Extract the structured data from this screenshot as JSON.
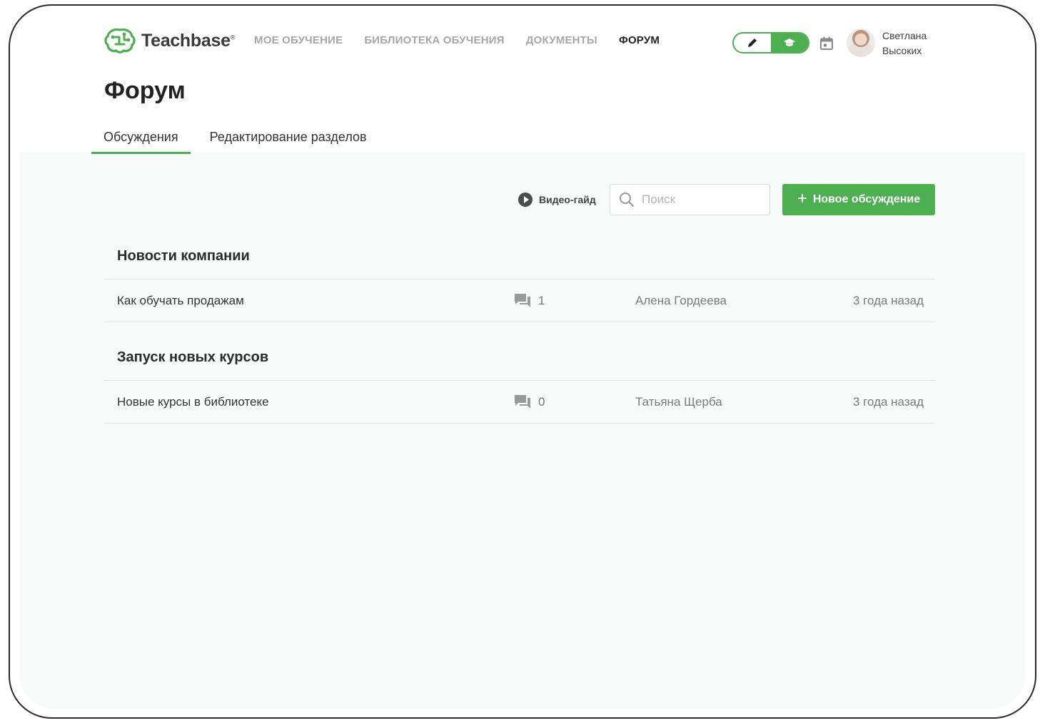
{
  "app": {
    "logo_text": "Teachbase",
    "logo_mark": "®"
  },
  "nav": [
    {
      "label": "МОЕ ОБУЧЕНИЕ",
      "active": false
    },
    {
      "label": "БИБЛИОТЕКА ОБУЧЕНИЯ",
      "active": false
    },
    {
      "label": "ДОКУМЕНТЫ",
      "active": false
    },
    {
      "label": "ФОРУМ",
      "active": true
    }
  ],
  "header": {
    "mode_toggle": {
      "left_icon": "pencil-icon",
      "right_icon": "graduation-cap-icon",
      "active": "right"
    },
    "calendar_icon": "calendar-icon",
    "user": {
      "first_name": "Светлана",
      "last_name": "Высоких"
    }
  },
  "page": {
    "title": "Форум",
    "tabs": [
      {
        "label": "Обсуждения",
        "active": true
      },
      {
        "label": "Редактирование разделов",
        "active": false
      }
    ]
  },
  "toolbar": {
    "video_guide": "Видео-гайд",
    "search_placeholder": "Поиск",
    "search_value": "",
    "new_button": "Новое обсуждение"
  },
  "sections": [
    {
      "title": "Новости компании",
      "topics": [
        {
          "title": "Как обучать продажам",
          "comments": "1",
          "author": "Алена Гордеева",
          "time": "3 года назад"
        }
      ]
    },
    {
      "title": "Запуск новых курсов",
      "topics": [
        {
          "title": "Новые курсы в библиотеке",
          "comments": "0",
          "author": "Татьяна Щерба",
          "time": "3 года назад"
        }
      ]
    }
  ],
  "colors": {
    "accent": "#4caf50",
    "nav_inactive": "#a6a6a6",
    "text": "#333333",
    "content_bg": "#f9fafa"
  }
}
